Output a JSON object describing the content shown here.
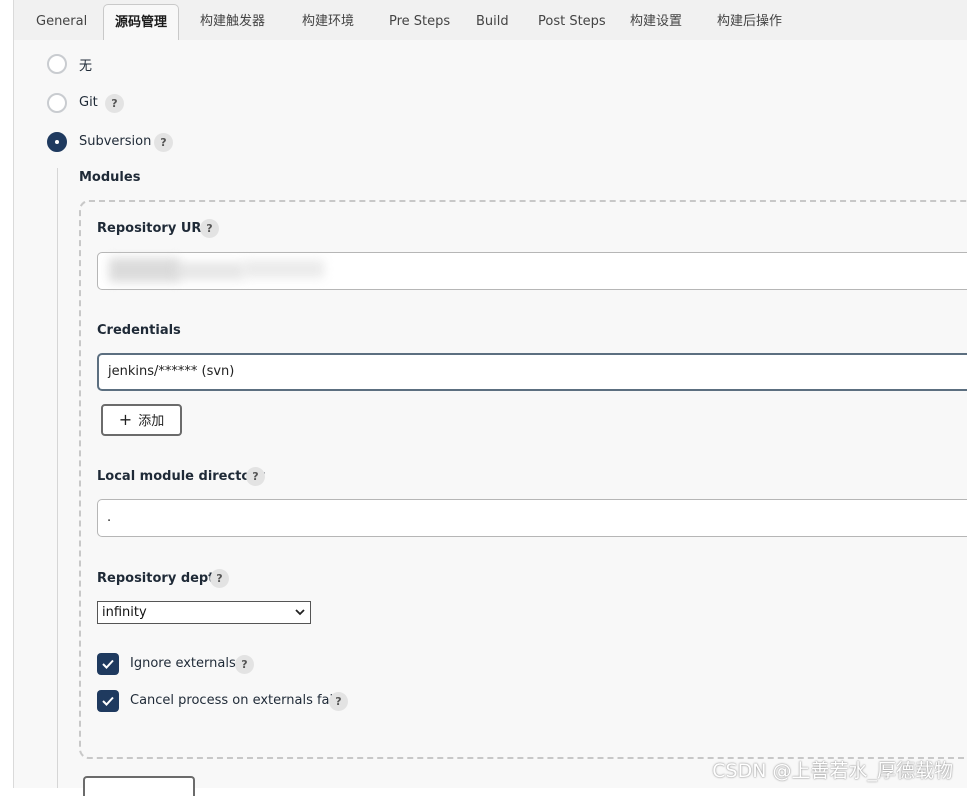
{
  "tabs": [
    {
      "label": "General"
    },
    {
      "label": "源码管理",
      "active": true
    },
    {
      "label": "构建触发器"
    },
    {
      "label": "构建环境"
    },
    {
      "label": "Pre Steps"
    },
    {
      "label": "Build"
    },
    {
      "label": "Post Steps"
    },
    {
      "label": "构建设置"
    },
    {
      "label": "构建后操作"
    }
  ],
  "scm_options": [
    {
      "label": "无",
      "selected": false
    },
    {
      "label": "Git",
      "selected": false,
      "help": "?"
    },
    {
      "label": "Subversion",
      "selected": true,
      "help": "?"
    }
  ],
  "modules": {
    "heading": "Modules",
    "repository_url": {
      "label": "Repository URL",
      "help": "?",
      "value": ""
    },
    "credentials": {
      "label": "Credentials",
      "value": "jenkins/****** (svn)",
      "add_label": "添加",
      "add_icon": "plus-icon"
    },
    "local_module_directory": {
      "label": "Local module directory",
      "help": "?",
      "value": "."
    },
    "repository_depth": {
      "label": "Repository depth",
      "help": "?",
      "value": "infinity"
    },
    "ignore_externals": {
      "label": "Ignore externals",
      "help": "?",
      "checked": true
    },
    "cancel_on_externals_fail": {
      "label": "Cancel process on externals fail",
      "help": "?",
      "checked": true
    }
  },
  "watermark": "CSDN @上善若水_厚德载物",
  "colors": {
    "accent": "#1f3a5f",
    "page_bg": "#f8f8f8",
    "tabbar_bg": "#f1f1f1",
    "help_bg": "#e3e3e3"
  }
}
